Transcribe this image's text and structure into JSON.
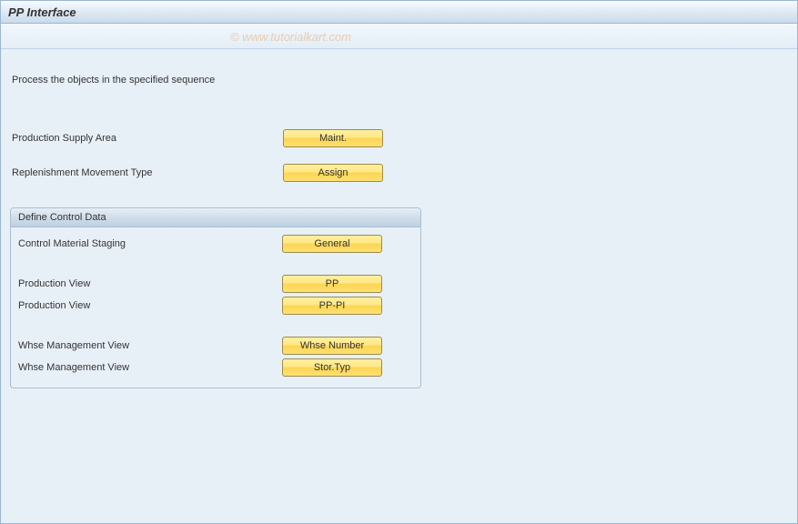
{
  "header": {
    "title": "PP Interface"
  },
  "watermark": "© www.tutorialkart.com",
  "instruction": "Process the objects in the specified sequence",
  "top_rows": [
    {
      "label": "Production Supply Area",
      "button": "Maint."
    },
    {
      "label": "Replenishment Movement Type",
      "button": "Assign"
    }
  ],
  "group": {
    "title": "Define Control Data",
    "sections": [
      [
        {
          "label": "Control Material Staging",
          "button": "General"
        }
      ],
      [
        {
          "label": "Production View",
          "button": "PP"
        },
        {
          "label": "Production View",
          "button": "PP-PI"
        }
      ],
      [
        {
          "label": "Whse Management View",
          "button": "Whse Number"
        },
        {
          "label": "Whse Management View",
          "button": "Stor.Typ"
        }
      ]
    ]
  }
}
